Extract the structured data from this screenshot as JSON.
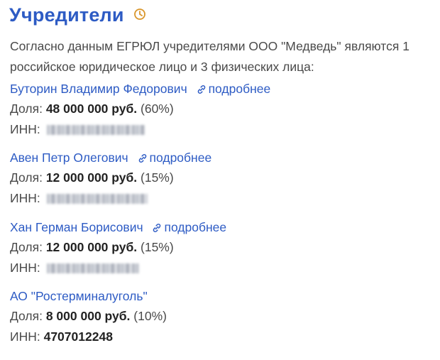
{
  "header": {
    "title": "Учредители",
    "icon": "clock-icon",
    "accent_color": "#2d5bc4"
  },
  "intro": "Согласно данным ЕГРЮЛ учредителями ООО \"Медведь\" являются 1 российское юридическое лицо и 3 физических лица:",
  "labels": {
    "share": "Доля:",
    "inn": "ИНН:",
    "more": "подробнее"
  },
  "founders": [
    {
      "name": "Буторин Владимир Федорович",
      "has_more": true,
      "amount": "48 000 000 руб.",
      "percent": "(60%)",
      "inn": null,
      "inn_blurred": true
    },
    {
      "name": "Авен Петр Олегович",
      "has_more": true,
      "amount": "12 000 000 руб.",
      "percent": "(15%)",
      "inn": null,
      "inn_blurred": true
    },
    {
      "name": "Хан Герман Борисович",
      "has_more": true,
      "amount": "12 000 000 руб.",
      "percent": "(15%)",
      "inn": null,
      "inn_blurred": true
    },
    {
      "name": "АО \"Ростерминалуголь\"",
      "has_more": false,
      "amount": "8 000 000 руб.",
      "percent": "(10%)",
      "inn": "4707012248",
      "inn_blurred": false
    }
  ]
}
